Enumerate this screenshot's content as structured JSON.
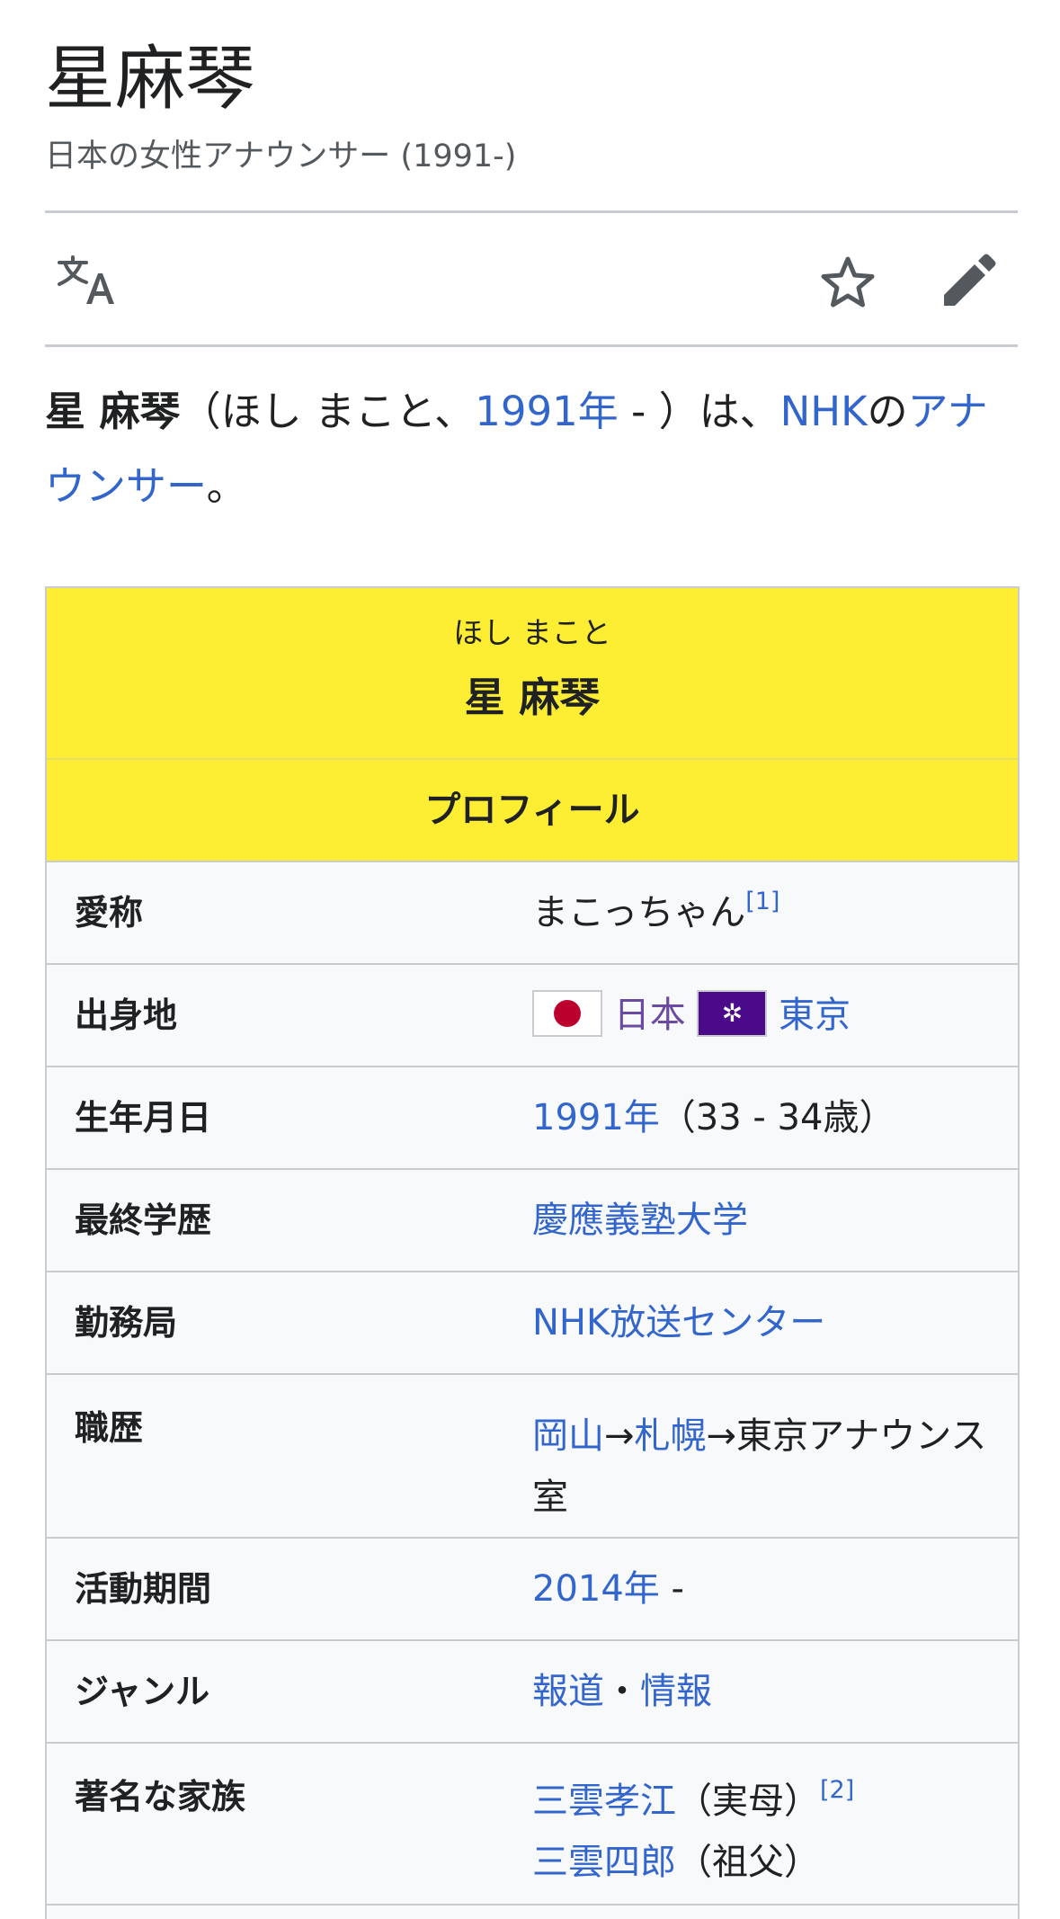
{
  "page": {
    "title": "星麻琴",
    "subtitle": "日本の女性アナウンサー (1991-)"
  },
  "toolbar": {
    "language_icon": "translate-icon",
    "watch_icon": "star-icon",
    "edit_icon": "pencil-icon"
  },
  "lead": {
    "name": "星 麻琴",
    "reading": "（ほし まこと、",
    "birth_year": "1991年",
    "mid": " - ）は、",
    "org": "NHK",
    "no": "の",
    "role": "アナウンサー",
    "end": "。"
  },
  "infobox": {
    "ruby": "ほし まこと",
    "name": "星 麻琴",
    "section": "プロフィール",
    "rows": {
      "nickname": {
        "label": "愛称",
        "value": "まこっちゃん",
        "ref": "[1]"
      },
      "hometown": {
        "label": "出身地",
        "flag1": "japan-flag",
        "country": "日本",
        "flag2": "tokyo-flag",
        "city": "東京"
      },
      "birth": {
        "label": "生年月日",
        "year": "1991年",
        "age": "（33 - 34歳）"
      },
      "education": {
        "label": "最終学歴",
        "value": "慶應義塾大学"
      },
      "workplace": {
        "label": "勤務局",
        "value": "NHK放送センター"
      },
      "career": {
        "label": "職歴",
        "link1": "岡山",
        "arrow1": "→",
        "link2": "札幌",
        "rest": "→東京アナウンス室"
      },
      "active": {
        "label": "活動期間",
        "year": "2014年",
        "dash": " -"
      },
      "genre": {
        "label": "ジャンル",
        "g1": "報道",
        "sep": "・",
        "g2": "情報"
      },
      "family": {
        "label": "著名な家族",
        "m1": "三雲孝江",
        "r1": "（実母）",
        "ref": "[2]",
        "m2": "三雲四郎",
        "r2": "（祖父）"
      }
    }
  },
  "colors": {
    "link": "#3366cc",
    "visited": "#6b4ba1",
    "header_yellow": "#fdee33",
    "border": "#c8ccd1"
  }
}
